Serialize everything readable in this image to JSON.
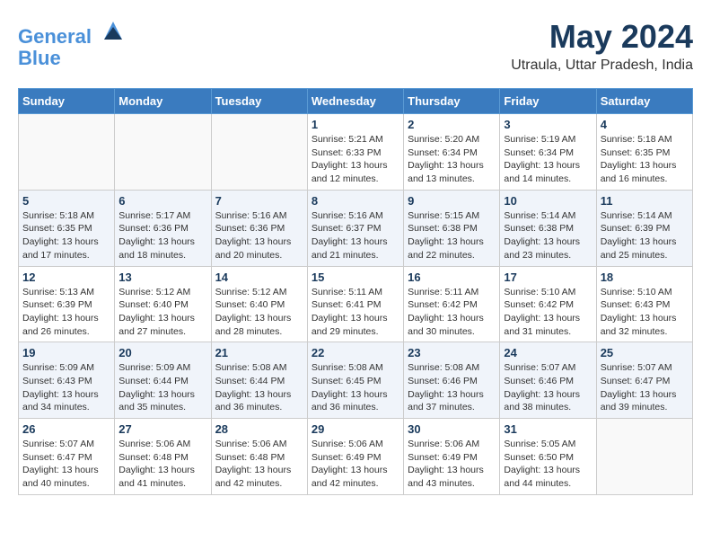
{
  "header": {
    "logo_line1": "General",
    "logo_line2": "Blue",
    "title": "May 2024",
    "subtitle": "Utraula, Uttar Pradesh, India"
  },
  "weekdays": [
    "Sunday",
    "Monday",
    "Tuesday",
    "Wednesday",
    "Thursday",
    "Friday",
    "Saturday"
  ],
  "weeks": [
    [
      {
        "day": "",
        "info": ""
      },
      {
        "day": "",
        "info": ""
      },
      {
        "day": "",
        "info": ""
      },
      {
        "day": "1",
        "info": "Sunrise: 5:21 AM\nSunset: 6:33 PM\nDaylight: 13 hours\nand 12 minutes."
      },
      {
        "day": "2",
        "info": "Sunrise: 5:20 AM\nSunset: 6:34 PM\nDaylight: 13 hours\nand 13 minutes."
      },
      {
        "day": "3",
        "info": "Sunrise: 5:19 AM\nSunset: 6:34 PM\nDaylight: 13 hours\nand 14 minutes."
      },
      {
        "day": "4",
        "info": "Sunrise: 5:18 AM\nSunset: 6:35 PM\nDaylight: 13 hours\nand 16 minutes."
      }
    ],
    [
      {
        "day": "5",
        "info": "Sunrise: 5:18 AM\nSunset: 6:35 PM\nDaylight: 13 hours\nand 17 minutes."
      },
      {
        "day": "6",
        "info": "Sunrise: 5:17 AM\nSunset: 6:36 PM\nDaylight: 13 hours\nand 18 minutes."
      },
      {
        "day": "7",
        "info": "Sunrise: 5:16 AM\nSunset: 6:36 PM\nDaylight: 13 hours\nand 20 minutes."
      },
      {
        "day": "8",
        "info": "Sunrise: 5:16 AM\nSunset: 6:37 PM\nDaylight: 13 hours\nand 21 minutes."
      },
      {
        "day": "9",
        "info": "Sunrise: 5:15 AM\nSunset: 6:38 PM\nDaylight: 13 hours\nand 22 minutes."
      },
      {
        "day": "10",
        "info": "Sunrise: 5:14 AM\nSunset: 6:38 PM\nDaylight: 13 hours\nand 23 minutes."
      },
      {
        "day": "11",
        "info": "Sunrise: 5:14 AM\nSunset: 6:39 PM\nDaylight: 13 hours\nand 25 minutes."
      }
    ],
    [
      {
        "day": "12",
        "info": "Sunrise: 5:13 AM\nSunset: 6:39 PM\nDaylight: 13 hours\nand 26 minutes."
      },
      {
        "day": "13",
        "info": "Sunrise: 5:12 AM\nSunset: 6:40 PM\nDaylight: 13 hours\nand 27 minutes."
      },
      {
        "day": "14",
        "info": "Sunrise: 5:12 AM\nSunset: 6:40 PM\nDaylight: 13 hours\nand 28 minutes."
      },
      {
        "day": "15",
        "info": "Sunrise: 5:11 AM\nSunset: 6:41 PM\nDaylight: 13 hours\nand 29 minutes."
      },
      {
        "day": "16",
        "info": "Sunrise: 5:11 AM\nSunset: 6:42 PM\nDaylight: 13 hours\nand 30 minutes."
      },
      {
        "day": "17",
        "info": "Sunrise: 5:10 AM\nSunset: 6:42 PM\nDaylight: 13 hours\nand 31 minutes."
      },
      {
        "day": "18",
        "info": "Sunrise: 5:10 AM\nSunset: 6:43 PM\nDaylight: 13 hours\nand 32 minutes."
      }
    ],
    [
      {
        "day": "19",
        "info": "Sunrise: 5:09 AM\nSunset: 6:43 PM\nDaylight: 13 hours\nand 34 minutes."
      },
      {
        "day": "20",
        "info": "Sunrise: 5:09 AM\nSunset: 6:44 PM\nDaylight: 13 hours\nand 35 minutes."
      },
      {
        "day": "21",
        "info": "Sunrise: 5:08 AM\nSunset: 6:44 PM\nDaylight: 13 hours\nand 36 minutes."
      },
      {
        "day": "22",
        "info": "Sunrise: 5:08 AM\nSunset: 6:45 PM\nDaylight: 13 hours\nand 36 minutes."
      },
      {
        "day": "23",
        "info": "Sunrise: 5:08 AM\nSunset: 6:46 PM\nDaylight: 13 hours\nand 37 minutes."
      },
      {
        "day": "24",
        "info": "Sunrise: 5:07 AM\nSunset: 6:46 PM\nDaylight: 13 hours\nand 38 minutes."
      },
      {
        "day": "25",
        "info": "Sunrise: 5:07 AM\nSunset: 6:47 PM\nDaylight: 13 hours\nand 39 minutes."
      }
    ],
    [
      {
        "day": "26",
        "info": "Sunrise: 5:07 AM\nSunset: 6:47 PM\nDaylight: 13 hours\nand 40 minutes."
      },
      {
        "day": "27",
        "info": "Sunrise: 5:06 AM\nSunset: 6:48 PM\nDaylight: 13 hours\nand 41 minutes."
      },
      {
        "day": "28",
        "info": "Sunrise: 5:06 AM\nSunset: 6:48 PM\nDaylight: 13 hours\nand 42 minutes."
      },
      {
        "day": "29",
        "info": "Sunrise: 5:06 AM\nSunset: 6:49 PM\nDaylight: 13 hours\nand 42 minutes."
      },
      {
        "day": "30",
        "info": "Sunrise: 5:06 AM\nSunset: 6:49 PM\nDaylight: 13 hours\nand 43 minutes."
      },
      {
        "day": "31",
        "info": "Sunrise: 5:05 AM\nSunset: 6:50 PM\nDaylight: 13 hours\nand 44 minutes."
      },
      {
        "day": "",
        "info": ""
      }
    ]
  ]
}
